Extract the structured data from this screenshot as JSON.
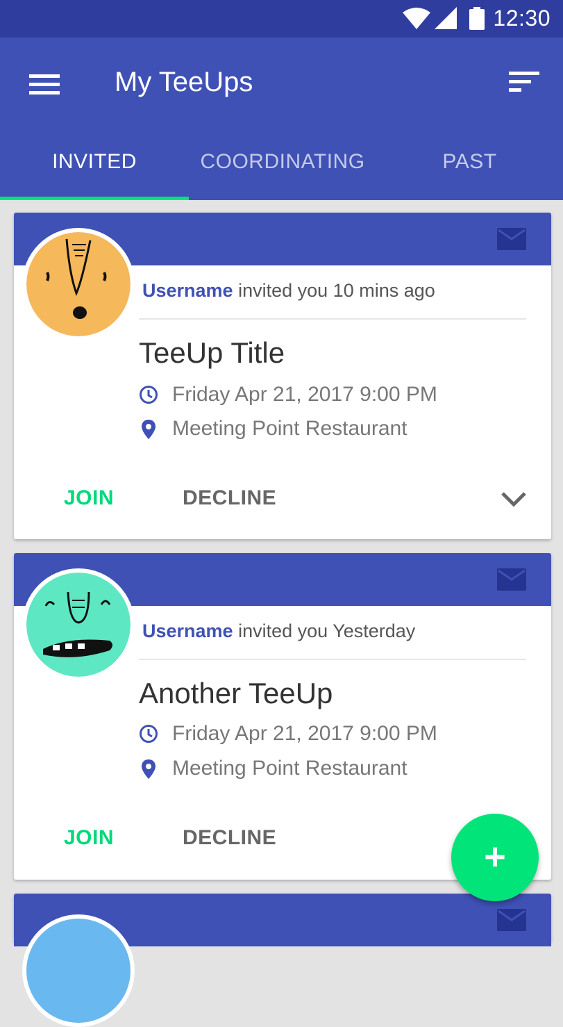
{
  "status_bar": {
    "time": "12:30",
    "icons": [
      "wifi-icon",
      "cell-signal-icon",
      "battery-icon"
    ]
  },
  "app_bar": {
    "title": "My TeeUps",
    "left_icon": "menu-icon",
    "right_icon": "sort-icon"
  },
  "tabs": [
    {
      "label": "INVITED",
      "active": true
    },
    {
      "label": "COORDINATING",
      "active": false
    },
    {
      "label": "PAST",
      "active": false
    }
  ],
  "cards": [
    {
      "username": "Username",
      "invite_text": "invited you 10 mins ago",
      "title": "TeeUp Title",
      "datetime": "Friday Apr 21, 2017 9:00 PM",
      "location": "Meeting Point Restaurant",
      "join_label": "JOIN",
      "decline_label": "DECLINE",
      "avatar_color": "#f5b85a"
    },
    {
      "username": "Username",
      "invite_text": "invited you Yesterday",
      "title": "Another TeeUp",
      "datetime": "Friday Apr 21, 2017 9:00 PM",
      "location": "Meeting Point Restaurant",
      "join_label": "JOIN",
      "decline_label": "DECLINE",
      "avatar_color": "#5de8c3"
    }
  ],
  "fab": {
    "label": "+"
  },
  "colors": {
    "primary": "#3f51b5",
    "primary_dark": "#2f3e9e",
    "accent": "#00e47a",
    "third_avatar": "#6ab8f0"
  }
}
